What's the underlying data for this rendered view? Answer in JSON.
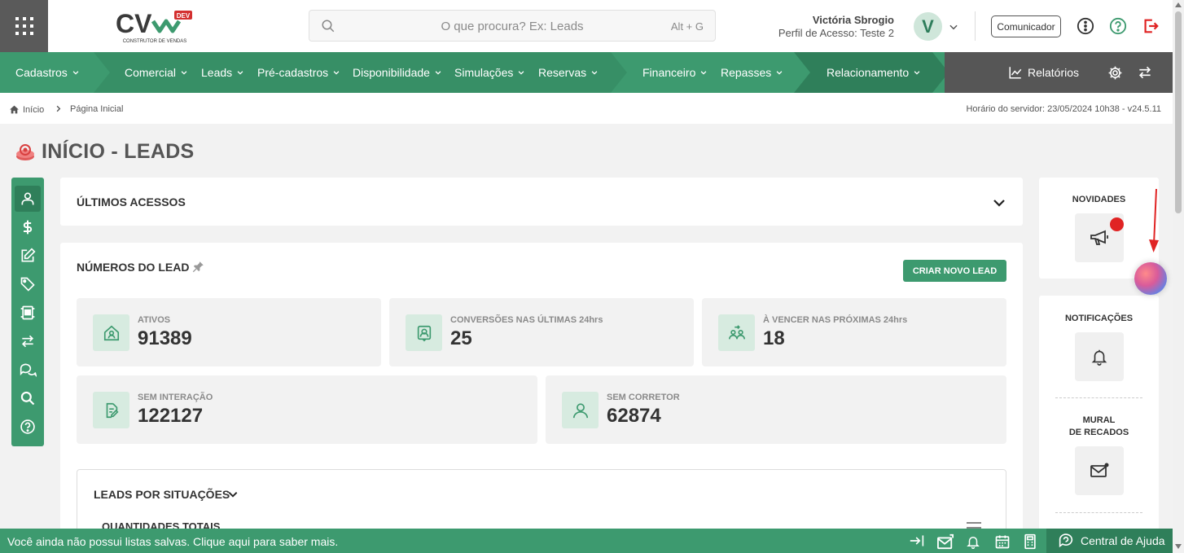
{
  "header": {
    "logo_text": "CV",
    "logo_badge": "DEV",
    "logo_sub": "CONSTRUTOR DE VENDAS",
    "search_placeholder": "O que procura? Ex: Leads",
    "search_shortcut": "Alt + G",
    "user_name": "Victória Sbrogio",
    "user_profile": "Perfil de Acesso: Teste 2",
    "avatar_letter": "V",
    "comunicador_label": "Comunicador"
  },
  "nav": {
    "items": [
      "Cadastros",
      "Comercial",
      "Leads",
      "Pré-cadastros",
      "Disponibilidade",
      "Simulações",
      "Reservas",
      "Financeiro",
      "Repasses",
      "Relacionamento"
    ],
    "relatorios": "Relatórios"
  },
  "breadcrumb": {
    "home": "Início",
    "current": "Página Inicial",
    "server_time": "Horário do servidor: 23/05/2024 10h38 - v24.5.11"
  },
  "page": {
    "title": "INÍCIO - LEADS"
  },
  "ultimos": {
    "title": "ÚLTIMOS ACESSOS"
  },
  "numeros": {
    "title": "NÚMEROS DO LEAD",
    "create_button": "CRIAR NOVO LEAD",
    "stats": [
      {
        "label": "ATIVOS",
        "value": "91389"
      },
      {
        "label": "CONVERSÕES NAS ÚLTIMAS 24hrs",
        "value": "25"
      },
      {
        "label": "À VENCER NAS PRÓXIMAS 24hrs",
        "value": "18"
      },
      {
        "label": "SEM INTERAÇÃO",
        "value": "122127"
      },
      {
        "label": "SEM CORRETOR",
        "value": "62874"
      }
    ]
  },
  "situacoes": {
    "title": "LEADS POR SITUAÇÕES",
    "subtitle": "QUANTIDADES TOTAIS"
  },
  "right": {
    "novidades": "NOVIDADES",
    "notificacoes": "NOTIFICAÇÕES",
    "mural_line1": "MURAL",
    "mural_line2": "DE RECADOS"
  },
  "footer": {
    "message": "Você ainda não possui listas salvas. Clique aqui para saber mais.",
    "help": "Central de Ajuda"
  },
  "colors": {
    "brand_green": "#3d9a6f",
    "dark_green": "#2f7f5a",
    "nav_gray": "#565656",
    "alert_red": "#e02424"
  }
}
